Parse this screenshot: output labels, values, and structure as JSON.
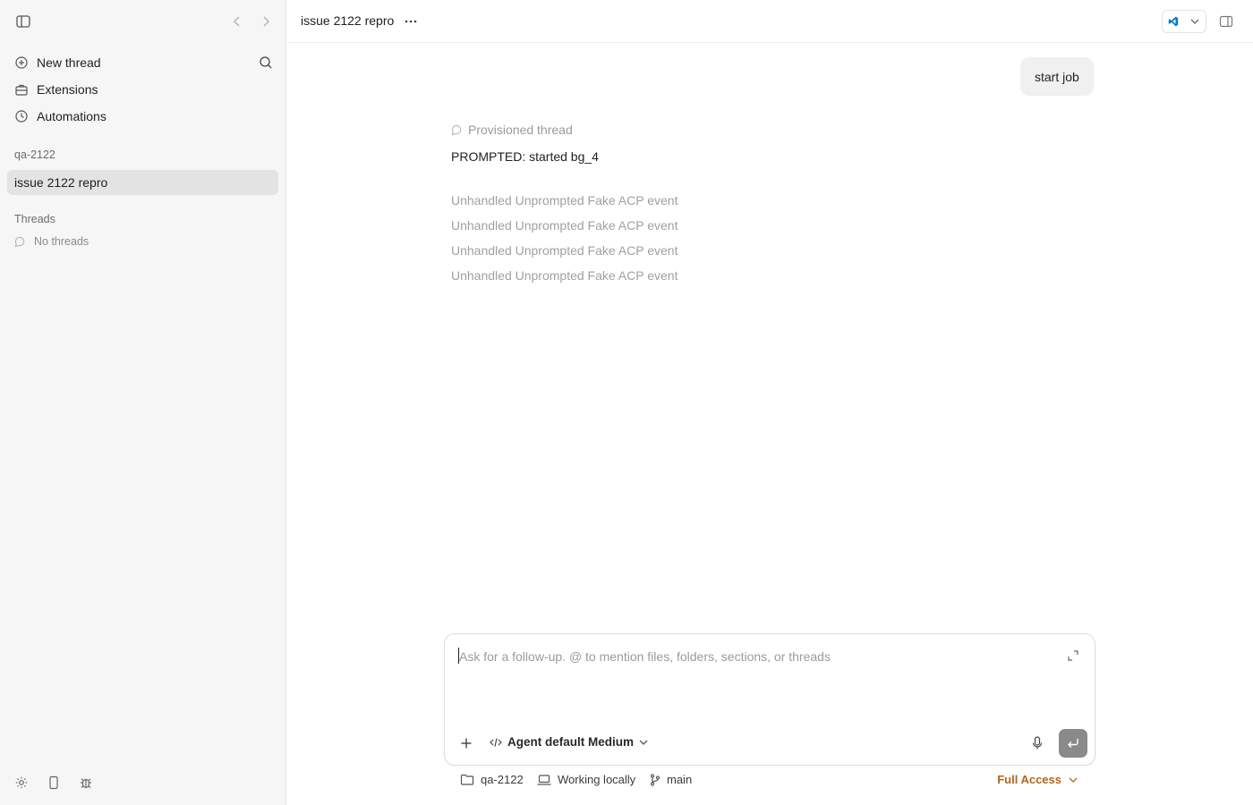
{
  "sidebar": {
    "nav": [
      {
        "label": "New thread",
        "icon": "plus-circle-icon"
      },
      {
        "label": "Extensions",
        "icon": "toolbox-icon"
      },
      {
        "label": "Automations",
        "icon": "clock-icon"
      }
    ],
    "project_section": "qa-2122",
    "project_item": "issue 2122 repro",
    "threads_section": "Threads",
    "no_threads": "No threads"
  },
  "header": {
    "title": "issue 2122 repro"
  },
  "conversation": {
    "user_message": "start job",
    "provisioned": "Provisioned thread",
    "prompted": "PROMPTED: started bg_4",
    "events": [
      "Unhandled Unprompted Fake ACP event",
      "Unhandled Unprompted Fake ACP event",
      "Unhandled Unprompted Fake ACP event",
      "Unhandled Unprompted Fake ACP event"
    ]
  },
  "composer": {
    "placeholder": "Ask for a follow-up. @ to mention files, folders, sections, or threads",
    "agent_label": "Agent default Medium"
  },
  "footer": {
    "project": "qa-2122",
    "environment": "Working locally",
    "branch": "main",
    "access": "Full Access"
  },
  "colors": {
    "sidebar_bg": "#f6f6f6",
    "selected_item_bg": "#e3e3e3",
    "access_accent": "#b5651d",
    "send_button": "#8a8a8a",
    "vscode_blue": "#0a78d4"
  }
}
